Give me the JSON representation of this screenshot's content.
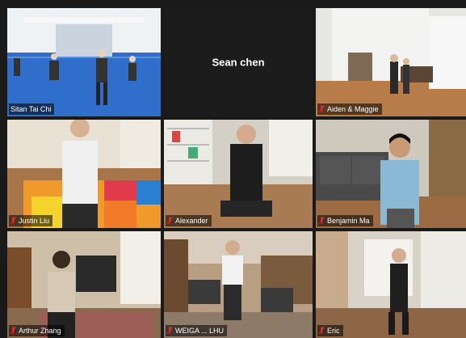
{
  "participants": [
    {
      "name": "Sitan Tai Chi",
      "video": true,
      "speaking": true
    },
    {
      "name": "Sean chen",
      "video": false,
      "speaking": false
    },
    {
      "name": "Aiden & Maggie",
      "video": true,
      "speaking": false
    },
    {
      "name": "Justin Liu",
      "video": true,
      "speaking": false
    },
    {
      "name": "Alexander",
      "video": true,
      "speaking": false
    },
    {
      "name": "Benjamin Ma",
      "video": true,
      "speaking": false
    },
    {
      "name": "Arthur Zhang",
      "video": true,
      "speaking": false
    },
    {
      "name": "WEIGA ... LHU",
      "video": true,
      "speaking": false
    },
    {
      "name": "Eric",
      "video": true,
      "speaking": false
    }
  ],
  "colors": {
    "speaker_outline": "#c9e34a",
    "muted_icon": "#e02828",
    "background": "#1a1a1a"
  }
}
